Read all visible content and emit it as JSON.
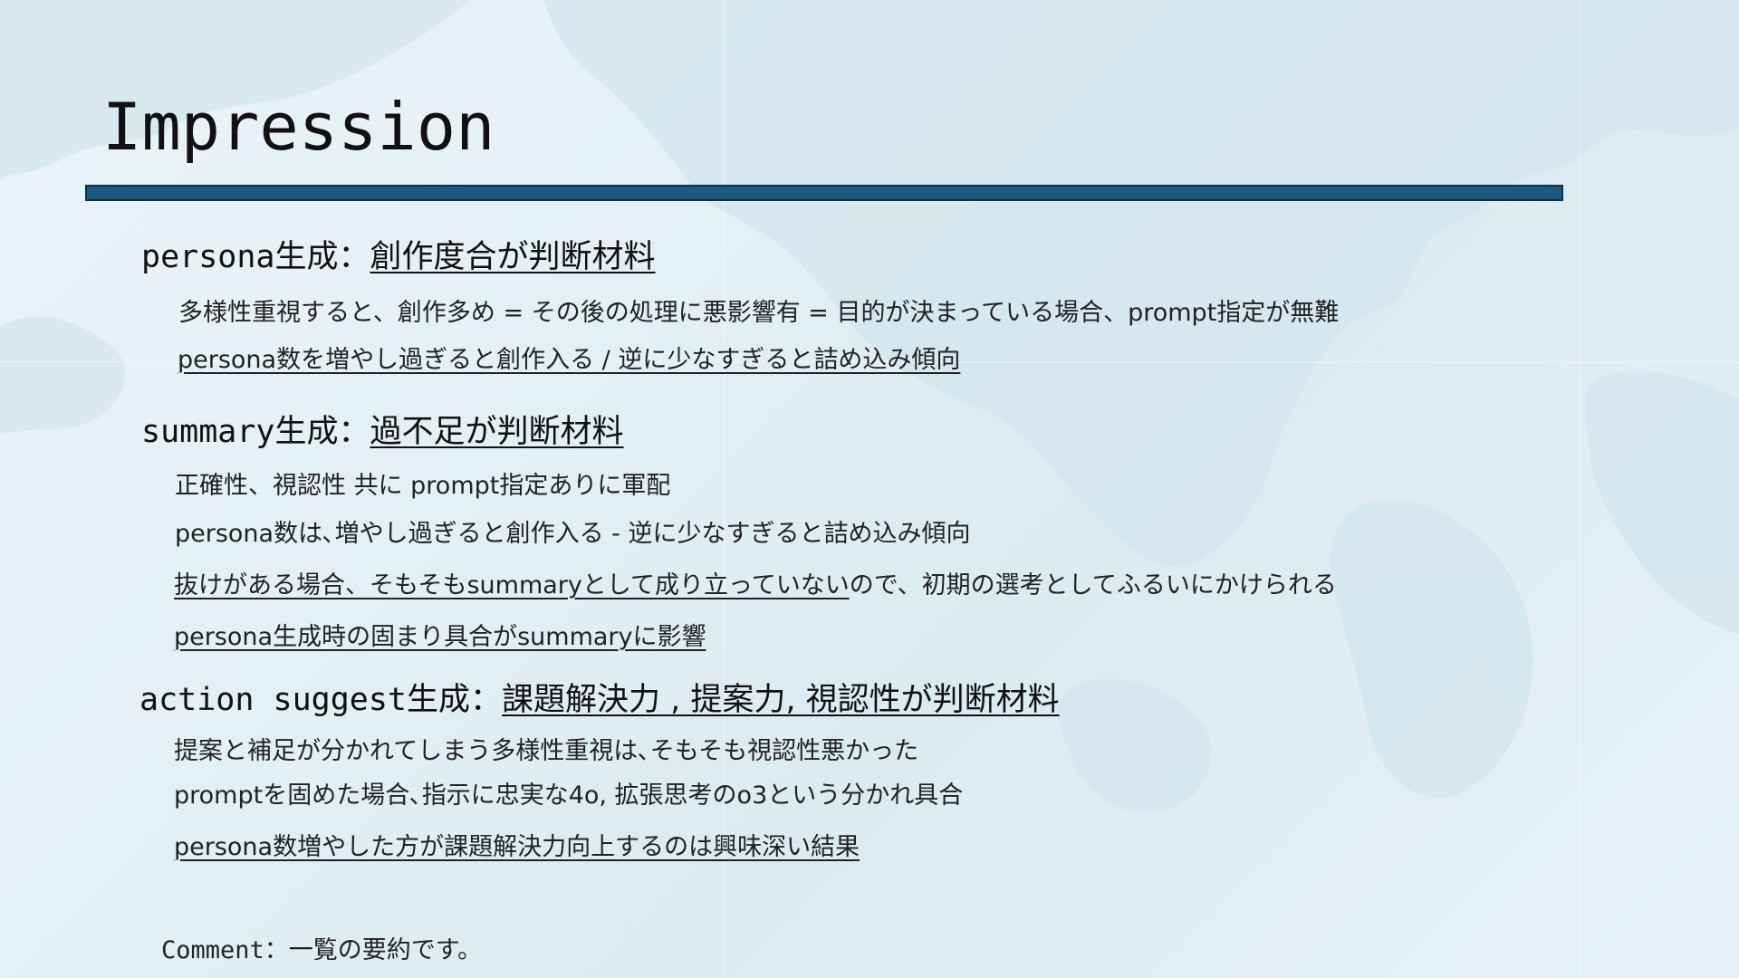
{
  "slide": {
    "title": "Impression",
    "sections": [
      {
        "heading_key": "persona生成",
        "heading_sep": "：",
        "heading_value": "創作度合が判断材料",
        "bullets": [
          "多様性重視すると、創作多め = その後の処理に悪影響有 = 目的が決まっている場合、prompt指定が無難",
          "persona数を増やし過ぎると創作入る / 逆に少なすぎると詰め込み傾向"
        ]
      },
      {
        "heading_key": "summary生成",
        "heading_sep": "：",
        "heading_value": "過不足が判断材料",
        "bullets": [
          "正確性、視認性 共に prompt指定ありに軍配",
          "persona数は､増やし過ぎると創作入る - 逆に少なすぎると詰め込み傾向",
          "抜けがある場合、そもそもsummaryとして成り立っていない",
          "ので、初期の選考としてふるいにかけられる",
          "persona生成時の固まり具合がsummaryに影響"
        ]
      },
      {
        "heading_key": "action suggest生成",
        "heading_sep": "：",
        "heading_value": "課題解決力 , 提案力, 視認性が判断材料",
        "bullets": [
          "提案と補足が分かれてしまう多様性重視は､そもそも視認性悪かった",
          "promptを固めた場合､指示に忠実な4o, 拡張思考のo3という分かれ具合",
          "persona数増やした方が課題解決力向上するのは興味深い結果"
        ]
      }
    ],
    "comment": {
      "label": "Comment",
      "sep": "：",
      "text": "一覧の要約です。"
    }
  }
}
